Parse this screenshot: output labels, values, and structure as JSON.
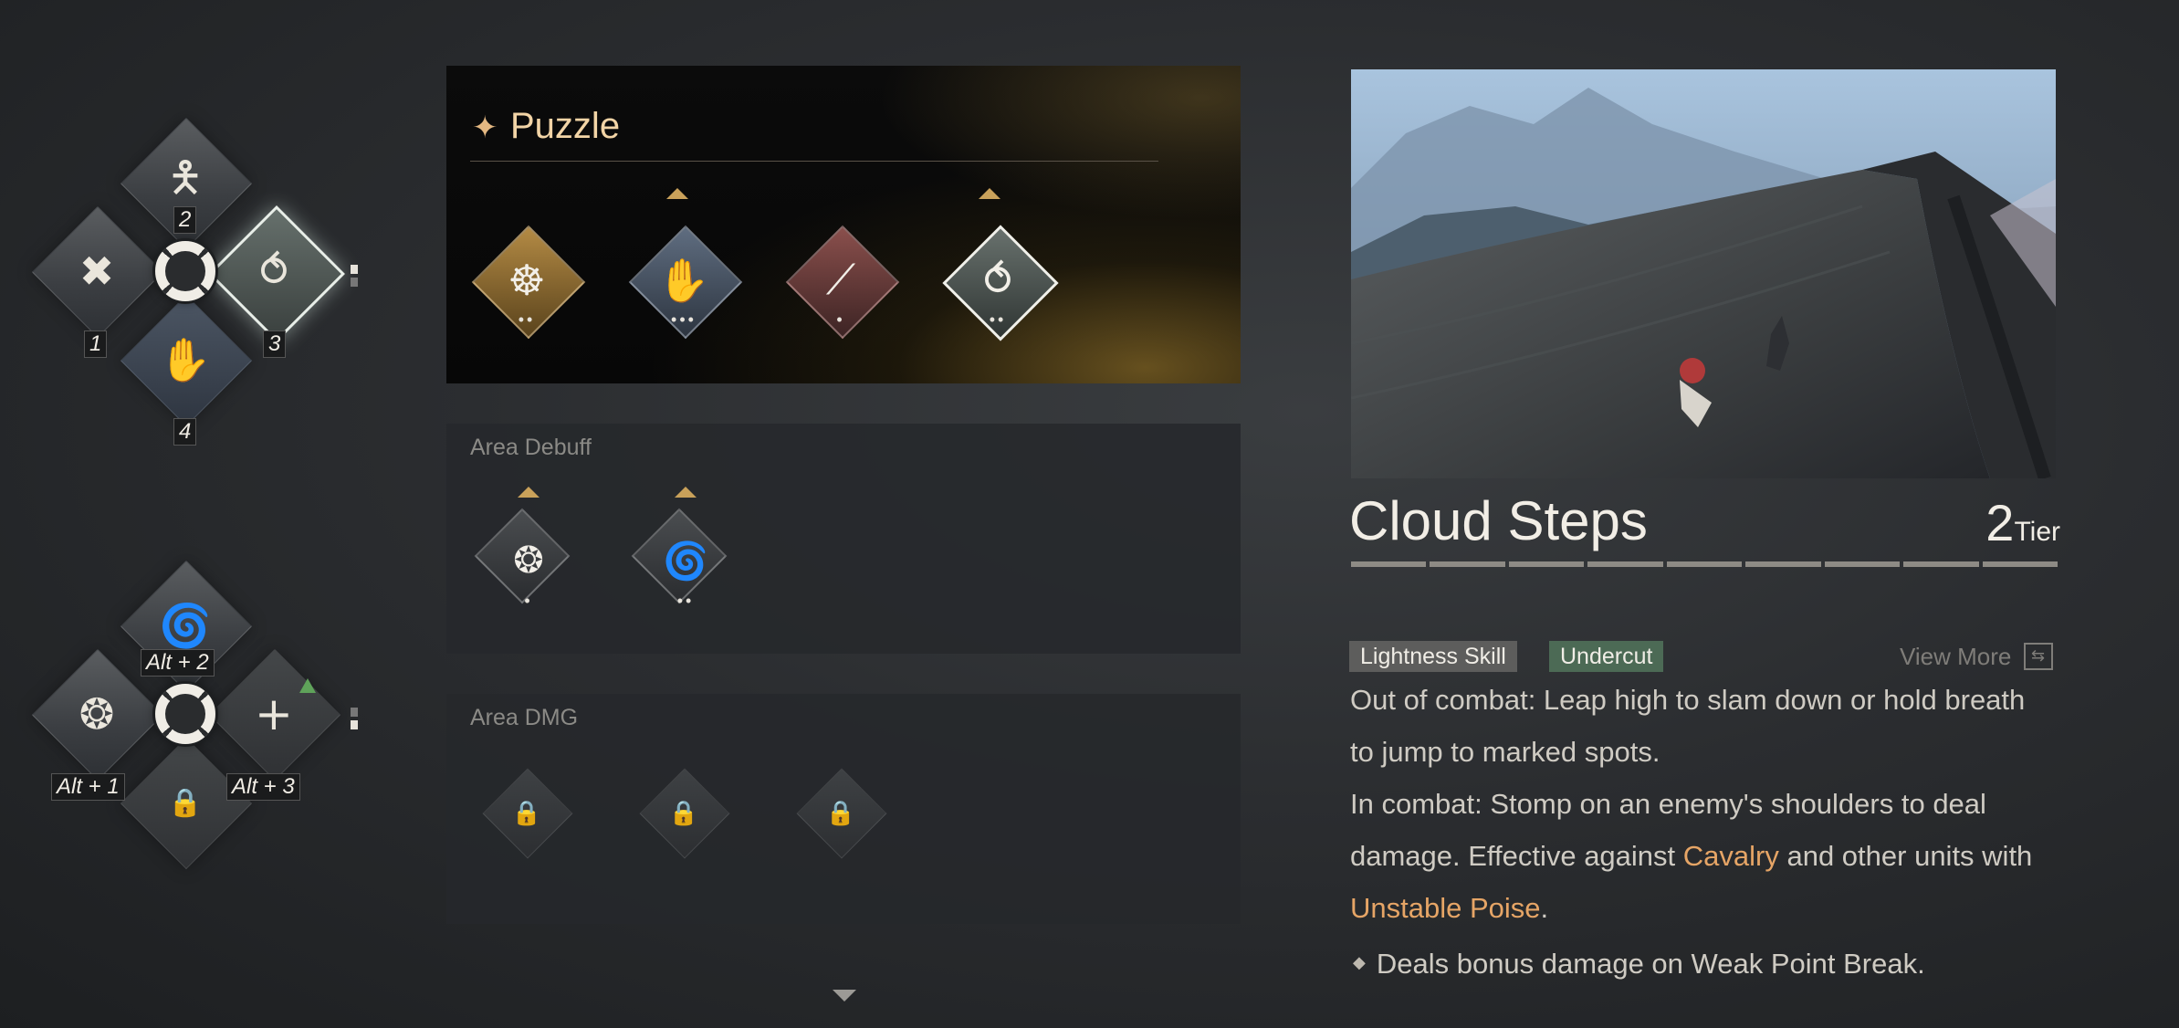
{
  "wheel_top": {
    "slot_keys": [
      "1",
      "2",
      "3",
      "4"
    ]
  },
  "wheel_bottom": {
    "slot_keys": [
      "Alt + 1",
      "Alt + 2",
      "Alt + 3"
    ],
    "plus_icon": "+"
  },
  "puzzle": {
    "title": "Puzzle",
    "skills": [
      {
        "icon": "archer-icon",
        "pips": "••",
        "checked": false
      },
      {
        "icon": "grapple-icon",
        "pips": "•••",
        "checked": true
      },
      {
        "icon": "claw-icon",
        "pips": "•",
        "checked": false
      },
      {
        "icon": "cloud-steps-icon",
        "pips": "••",
        "checked": true
      }
    ]
  },
  "area_debuff": {
    "title": "Area Debuff",
    "skills": [
      {
        "icon": "swirl-icon",
        "pips": "•",
        "checked": true
      },
      {
        "icon": "vortex-icon",
        "pips": "••",
        "checked": true
      }
    ]
  },
  "area_dmg": {
    "title": "Area DMG"
  },
  "detail": {
    "name": "Cloud Steps",
    "tier_value": "2",
    "tier_label": "Tier",
    "tags": [
      "Lightness Skill",
      "Undercut"
    ],
    "view_more": "View More",
    "line1": "Out of combat: Leap high to slam down or hold breath",
    "line2": "to jump to marked spots.",
    "line3": "In combat: Stomp on an enemy's shoulders to deal",
    "line4a": "damage. Effective against ",
    "line4b": "Cavalry",
    "line4c": " and other units with",
    "line5a": "Unstable Poise",
    "line5b": ".",
    "bullet": "Deals bonus damage on Weak Point Break."
  },
  "colors": {
    "highlight": "#e6a566",
    "tag_lightness": "#5d5d5c",
    "tag_undercut": "#4c6a55"
  }
}
